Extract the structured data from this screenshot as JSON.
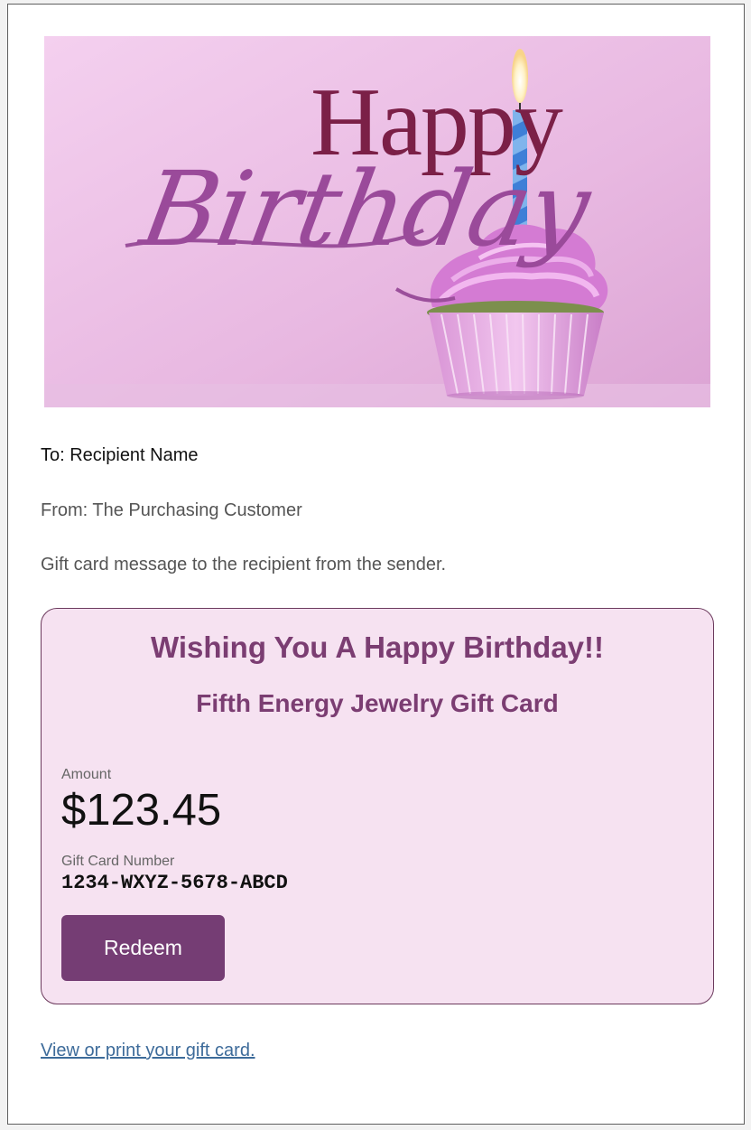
{
  "hero": {
    "happy_text": "Happy",
    "birthday_text": "Birthday"
  },
  "email": {
    "to_line": "To: Recipient Name",
    "from_line": "From: The Purchasing Customer",
    "message_line": "Gift card message to the recipient from the sender."
  },
  "card": {
    "wishing_text": "Wishing You A Happy Birthday!!",
    "title": "Fifth Energy Jewelry Gift Card",
    "amount_label": "Amount",
    "amount_value": "$123.45",
    "number_label": "Gift Card Number",
    "number_value": "1234-WXYZ-5678-ABCD",
    "redeem_label": "Redeem"
  },
  "footer": {
    "view_link": "View or print your gift card."
  },
  "colors": {
    "accent": "#753d74",
    "card_background": "#f6e2f1",
    "link": "#3d6b9a",
    "heading": "#7b3d72"
  }
}
